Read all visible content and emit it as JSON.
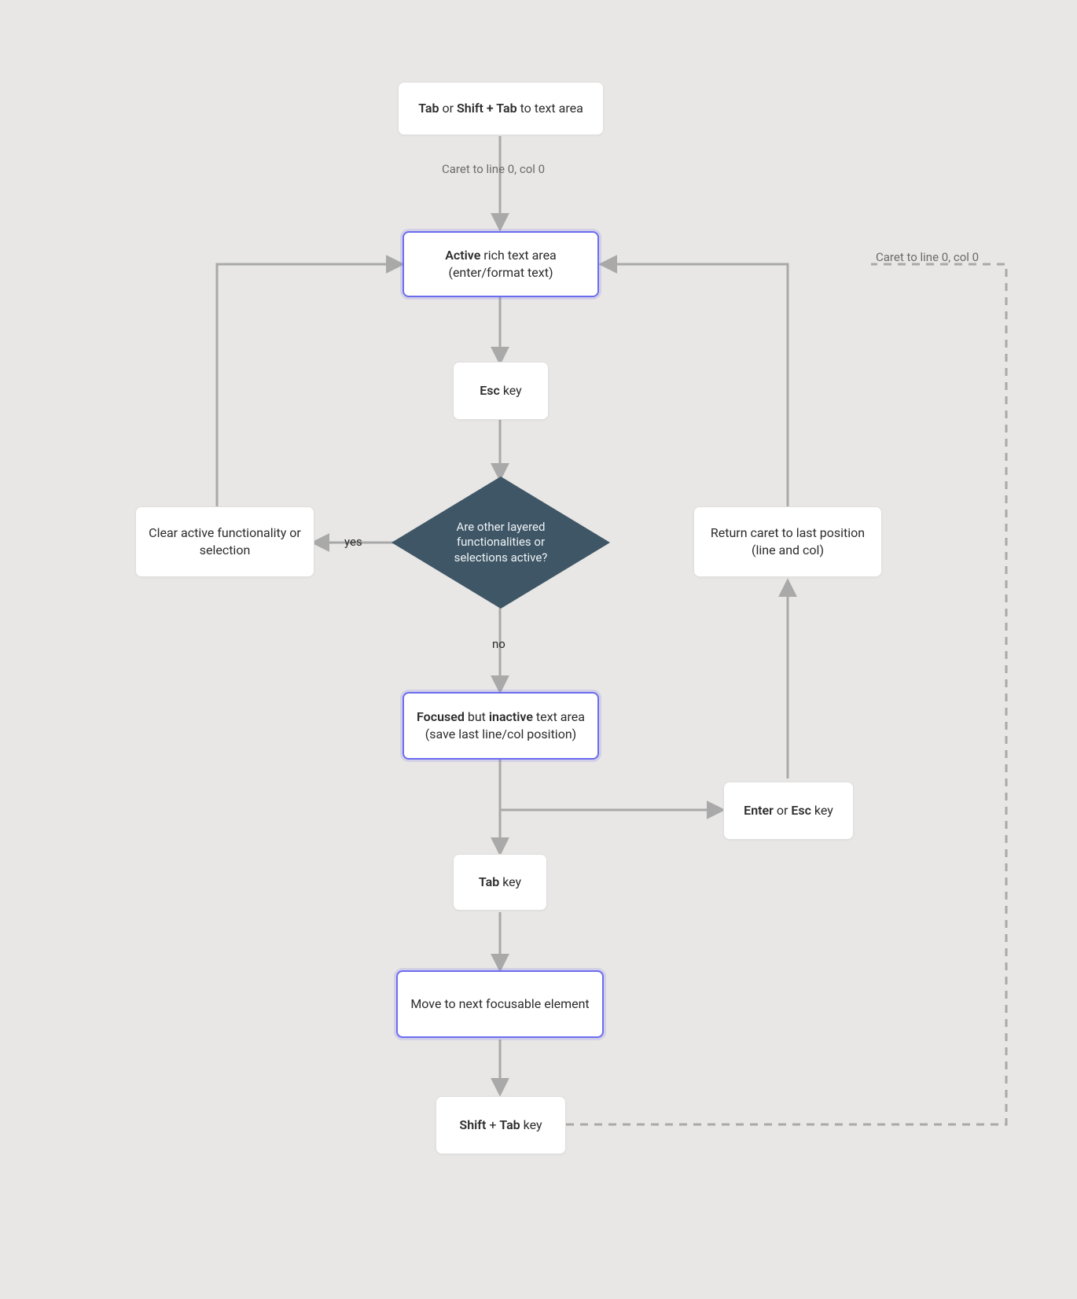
{
  "nodes": {
    "start": {
      "tab_bold": "Tab",
      "or": " or ",
      "shift_tab_bold": "Shift + Tab",
      "suffix": " to text area"
    },
    "caret_label": "Caret to line 0, col 0",
    "active": {
      "active_bold": "Active",
      "line1": " rich text area",
      "line2": "(enter/format text)"
    },
    "esc": {
      "esc_bold": "Esc",
      "suffix": " key"
    },
    "decision": {
      "l1": "Are other layered",
      "l2": "functionalities or",
      "l3": "selections active?"
    },
    "yes_label": "yes",
    "no_label": "no",
    "clear": "Clear active functionality or selection",
    "return": {
      "l1": "Return caret to last position",
      "l2": "(line and col)"
    },
    "focused": {
      "focused_bold": "Focused",
      "mid": " but ",
      "inactive_bold": "inactive",
      "l1_suffix": " text area",
      "l2": "(save last line/col position)"
    },
    "enter_esc": {
      "enter_bold": "Enter",
      "or": " or ",
      "esc_bold": "Esc",
      "suffix": " key"
    },
    "tabkey": {
      "tab_bold": "Tab",
      "suffix": " key"
    },
    "move_next": "Move to next focusable element",
    "shift_tab": {
      "shift_bold": "Shift",
      "plus": " + ",
      "tab_bold": "Tab",
      "suffix": " key"
    },
    "caret_label2": "Caret to line 0, col 0"
  },
  "colors": {
    "bg": "#e8e7e5",
    "box": "#ffffff",
    "boxBorder": "#dfdfdf",
    "focus": "#6c6cf0",
    "decision": "#3f5666",
    "arrow": "#a9a9a9",
    "text": "#2b2b2b",
    "muted": "#6b6b6b"
  }
}
